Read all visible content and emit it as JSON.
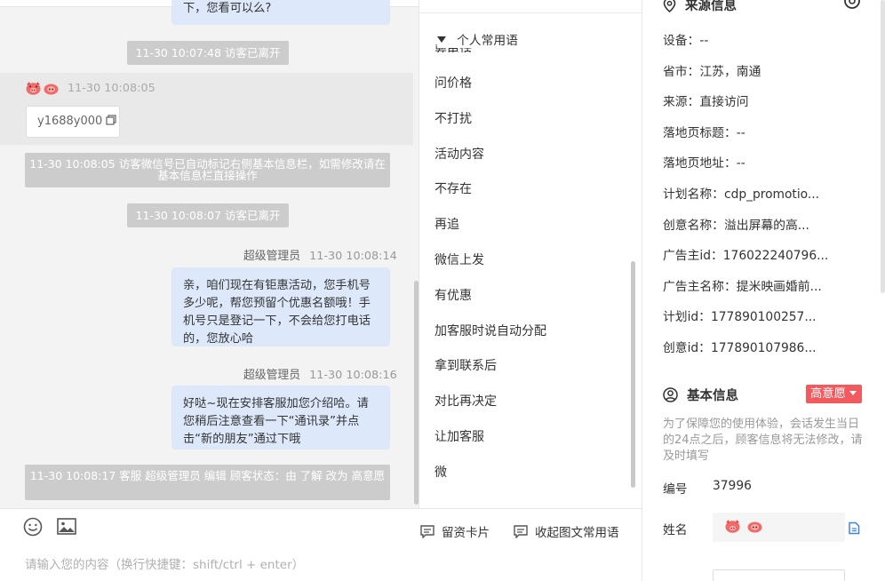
{
  "chat": {
    "top_bubble_tail": "下，您看可以么?",
    "pill_leave_1": "11-30 10:07:48 访客已离开",
    "visitor_time": "11-30 10:08:05",
    "visitor_wechat_id": "y1688y000",
    "pill_auto_tag": "11-30 10:08:05 访客微信号已自动标记右侧基本信息栏，如需修改请在基本信息栏直接操作",
    "pill_leave_2": "11-30 10:08:07 访客已离开",
    "msg1": {
      "sender": "超级管理员",
      "time": "11-30 10:08:14",
      "text": "亲，咱们现在有钜惠活动，您手机号多少呢，帮您预留个优惠名额哦！手机号只是登记一下，不会给您打电话的，您放心哈"
    },
    "msg2": {
      "sender": "超级管理员",
      "time": "11-30 10:08:16",
      "text": "好哒~现在安排客服加您介绍哈。请您稍后注意查看一下“通讯录”并点击“新的朋友”通过下哦"
    },
    "pill_status": "11-30 10:08:17 客服 超级管理员 编辑 顾客状态：由 了解 改为 高意愿"
  },
  "toolbar": {
    "emoji_icon": "smile-icon",
    "image_icon": "image-icon",
    "lead_card_label": "留资卡片",
    "collapse_label": "收起图文常用语",
    "input_placeholder": "请输入您的内容（换行快捷键：shift/ctrl + enter）"
  },
  "phrases": {
    "group_title": "个人常用语",
    "clipped_item": "要电话",
    "items": [
      "问价格",
      "不打扰",
      "活动内容",
      "不存在",
      "再追",
      "微信上发",
      "有优惠",
      "加客服时说自动分配",
      "拿到联系后",
      "对比再决定",
      "让加客服",
      "微"
    ]
  },
  "source": {
    "title": "来源信息",
    "rows": [
      "设备：--",
      "省市：江苏，南通",
      "来源：直接访问",
      "落地页标题：--",
      "落地页地址：--",
      "计划名称：cdp_promotio...",
      "创意名称：溢出屏幕的高...",
      "广告主id：176022240796...",
      "广告主名称：提米映画婚前...",
      "计划id：177890100257...",
      "创意id：177890107986..."
    ]
  },
  "basic": {
    "title": "基本信息",
    "intent_badge": "高意愿",
    "notice": "为了保障您的使用体验，会话发生当日的24点之后，顾客信息将无法修改，请及时填写",
    "id_label": "编号",
    "id_value": "37996",
    "name_label": "姓名"
  },
  "colors": {
    "accent_blue": "#3b82f6",
    "badge_red": "#f25a5f",
    "bubble_blue": "#dde9fb",
    "pill_gray": "#cccccc"
  }
}
